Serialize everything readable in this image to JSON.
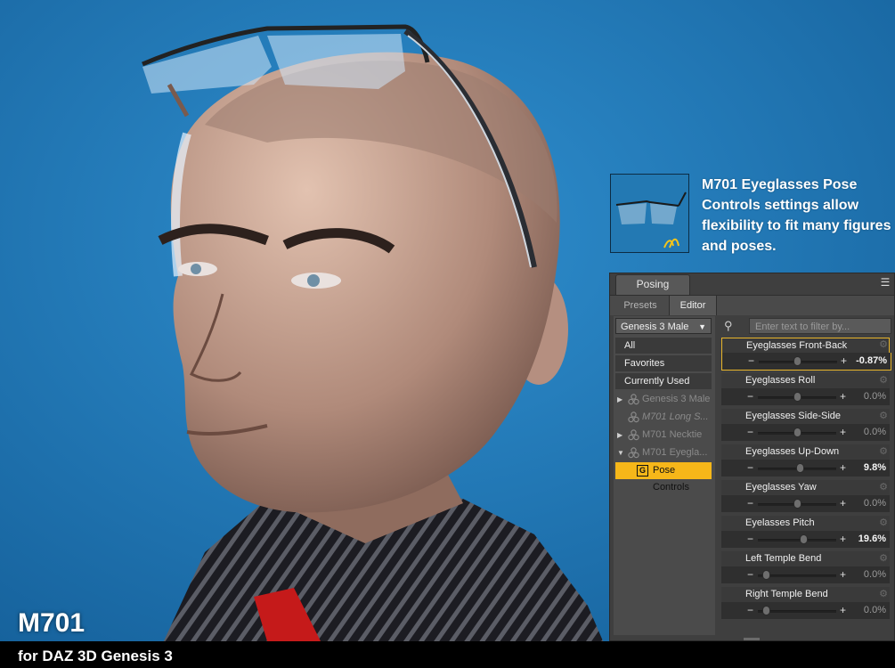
{
  "promo": {
    "product_code": "M701",
    "caption": "for DAZ 3D Genesis 3",
    "description": "M701 Eyeglasses Pose Controls settings allow flexibility to fit many figures and poses."
  },
  "pane": {
    "title": "Posing",
    "tabs": [
      {
        "label": "Presets"
      },
      {
        "label": "Editor"
      }
    ],
    "figure_select": "Genesis 3 Male",
    "filter_placeholder": "Enter text to filter by...",
    "tree": [
      {
        "label": "All"
      },
      {
        "label": "Favorites"
      },
      {
        "label": "Currently Used"
      },
      {
        "label": "Genesis 3 Male"
      },
      {
        "label": "M701 Long S..."
      },
      {
        "label": "M701 Necktie"
      },
      {
        "label": "M701 Eyegla..."
      },
      {
        "label": "Pose Controls",
        "badge": "G"
      }
    ],
    "sliders": [
      {
        "label": "Eyeglasses Front-Back",
        "value": "-0.87%",
        "level": -0.0087
      },
      {
        "label": "Eyeglasses Roll",
        "value": "0.0%",
        "level": 0
      },
      {
        "label": "Eyeglasses Side-Side",
        "value": "0.0%",
        "level": 0
      },
      {
        "label": "Eyeglasses Up-Down",
        "value": "9.8%",
        "level": 0.098
      },
      {
        "label": "Eyeglasses Yaw",
        "value": "0.0%",
        "level": 0
      },
      {
        "label": "Eyelasses Pitch",
        "value": "19.6%",
        "level": 0.196
      },
      {
        "label": "Left Temple Bend",
        "value": "0.0%",
        "level": -0.9
      },
      {
        "label": "Right Temple Bend",
        "value": "0.0%",
        "level": -0.9
      }
    ]
  },
  "colors": {
    "background": "#1d6fa8",
    "accent": "#f6b719"
  }
}
